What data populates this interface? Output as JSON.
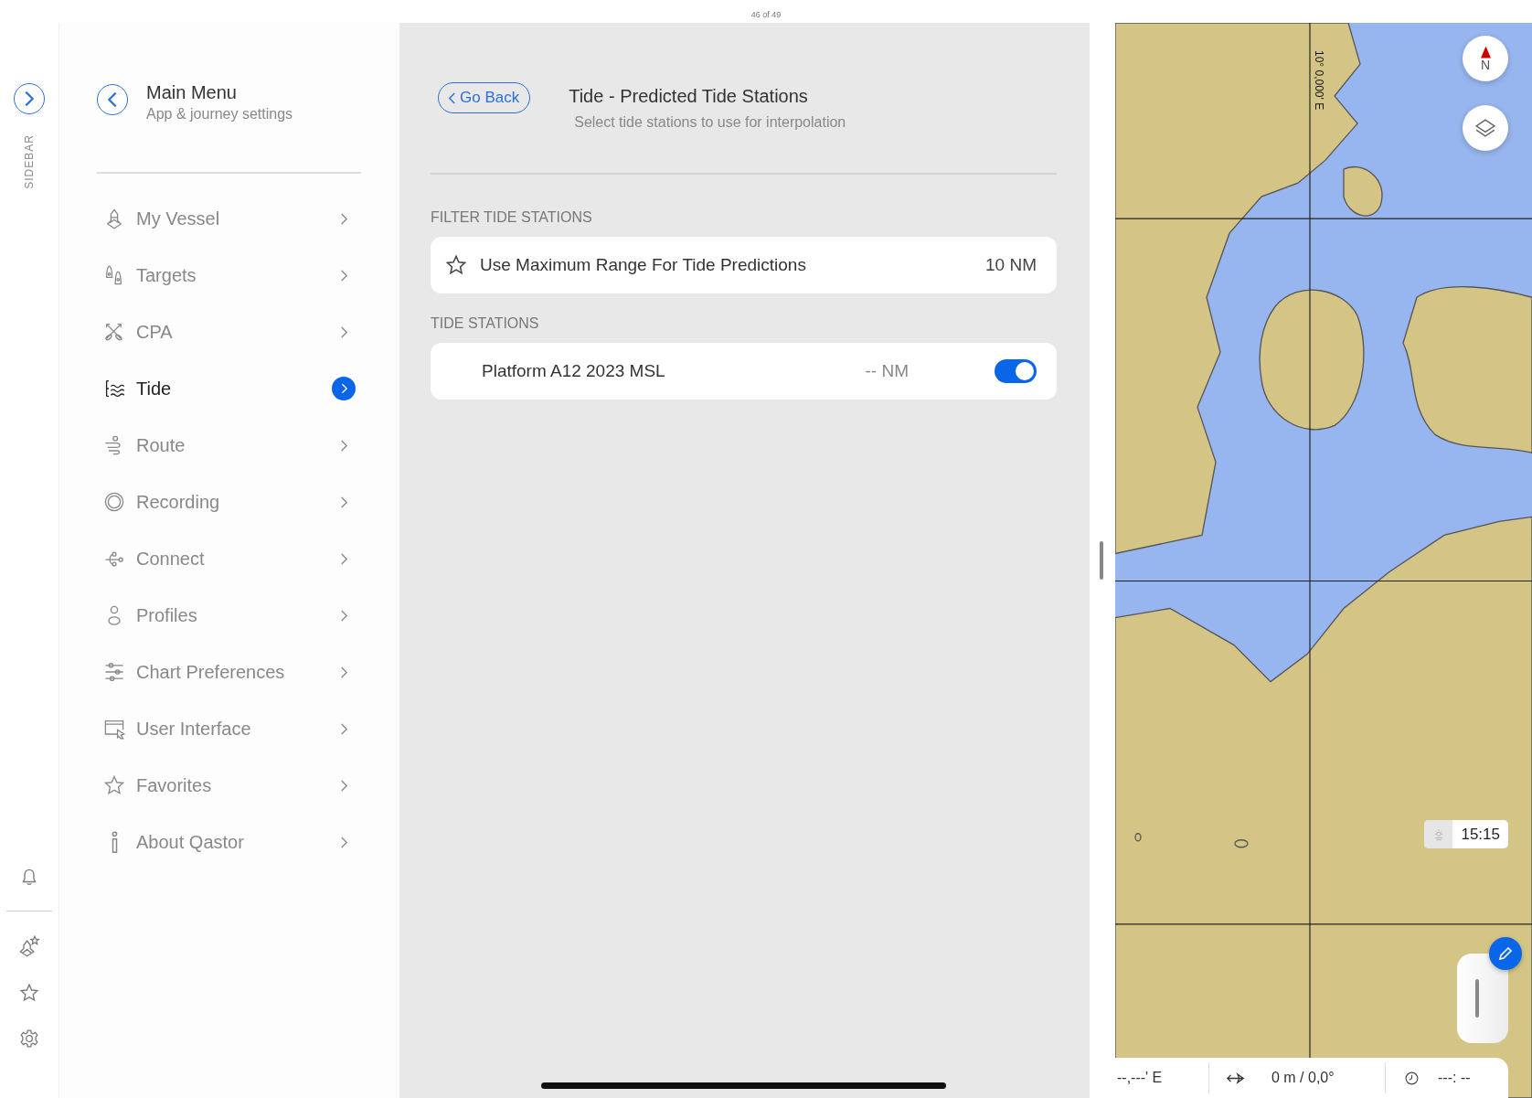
{
  "header": {
    "page_counter": "46 of 49"
  },
  "sidebar": {
    "label": "SIDEBAR"
  },
  "main_menu": {
    "title": "Main Menu",
    "subtitle": "App & journey settings",
    "items": [
      {
        "label": "My Vessel",
        "selected": false
      },
      {
        "label": "Targets",
        "selected": false
      },
      {
        "label": "CPA",
        "selected": false
      },
      {
        "label": "Tide",
        "selected": true
      },
      {
        "label": "Route",
        "selected": false
      },
      {
        "label": "Recording",
        "selected": false
      },
      {
        "label": "Connect",
        "selected": false
      },
      {
        "label": "Profiles",
        "selected": false
      },
      {
        "label": "Chart Preferences",
        "selected": false
      },
      {
        "label": "User Interface",
        "selected": false
      },
      {
        "label": "Favorites",
        "selected": false
      },
      {
        "label": "About Qastor",
        "selected": false
      }
    ]
  },
  "detail": {
    "back_label": "Go Back",
    "title": "Tide - Predicted Tide Stations",
    "subtitle": "Select tide stations to use for interpolation",
    "sections": [
      {
        "heading": "FILTER TIDE STATIONS",
        "rows": [
          {
            "kind": "range",
            "label": "Use Maximum Range For Tide Predictions",
            "value": "10 NM"
          }
        ]
      },
      {
        "heading": "TIDE STATIONS",
        "rows": [
          {
            "kind": "station",
            "label": "Platform A12 2023 MSL",
            "value": "-- NM",
            "on": true
          }
        ]
      }
    ]
  },
  "map": {
    "grid_label": "10° 0,000' E",
    "compass_label": "N",
    "time": "15:15",
    "status": [
      {
        "kind": "position",
        "text": "--,---' E"
      },
      {
        "kind": "course",
        "text": "0 m / 0,0°"
      },
      {
        "kind": "eta",
        "text": "---: --"
      }
    ]
  }
}
